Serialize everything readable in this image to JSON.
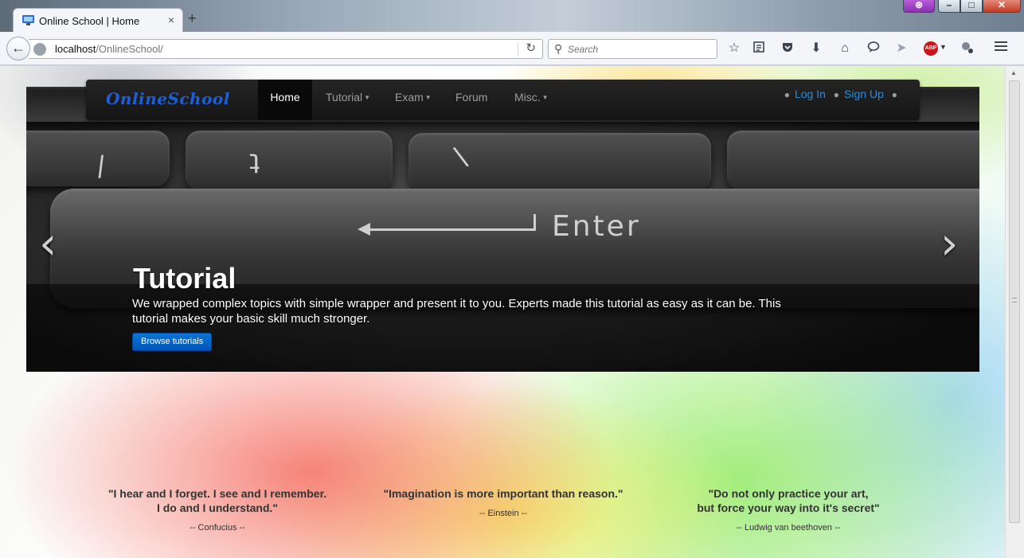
{
  "browser": {
    "tab_title": "Online School | Home",
    "tab_close": "×",
    "new_tab": "+",
    "url_host": "localhost",
    "url_path": "/OnlineSchool/",
    "search_placeholder": "Search",
    "icons": [
      "back-arrow-icon",
      "globe-icon",
      "reload-icon",
      "search-icon",
      "bookmark-star-icon",
      "reading-list-icon",
      "pocket-icon",
      "download-icon",
      "home-icon",
      "chat-icon",
      "send-icon",
      "adblock-plus-icon",
      "extension-icon",
      "menu-hamburger-icon"
    ],
    "adblock_label": "ABP"
  },
  "site": {
    "brand": "OnlineSchool",
    "nav": {
      "home": "Home",
      "tutorial": "Tutorial",
      "exam": "Exam",
      "forum": "Forum",
      "misc": "Misc."
    },
    "account": {
      "login": "Log In",
      "signup": "Sign Up"
    }
  },
  "carousel": {
    "title": "Tutorial",
    "text": "We wrapped complex topics with simple wrapper and present it to you. Experts made this tutorial as easy as it can be. This tutorial makes your basic skill much stronger.",
    "button": "Browse tutorials",
    "prev": "‹",
    "next": "›",
    "key_label": "Enter"
  },
  "quotes": [
    {
      "line1": "\"I hear and I forget. I see and I remember.",
      "line2": "I do and I understand.\"",
      "author": "-- Confucius --"
    },
    {
      "line1": "\"Imagination is more important than reason.\"",
      "line2": "",
      "author": "-- Einstein --"
    },
    {
      "line1": "\"Do not only practice your art,",
      "line2": "but force your way into it's secret\"",
      "author": "-- Ludwig van beethoven --"
    }
  ],
  "colors": {
    "brand_blue": "#1d5fd6",
    "link_blue": "#2a8bdc",
    "button_blue": "#0a76d8",
    "navbar_dark": "#1c1c1c"
  }
}
